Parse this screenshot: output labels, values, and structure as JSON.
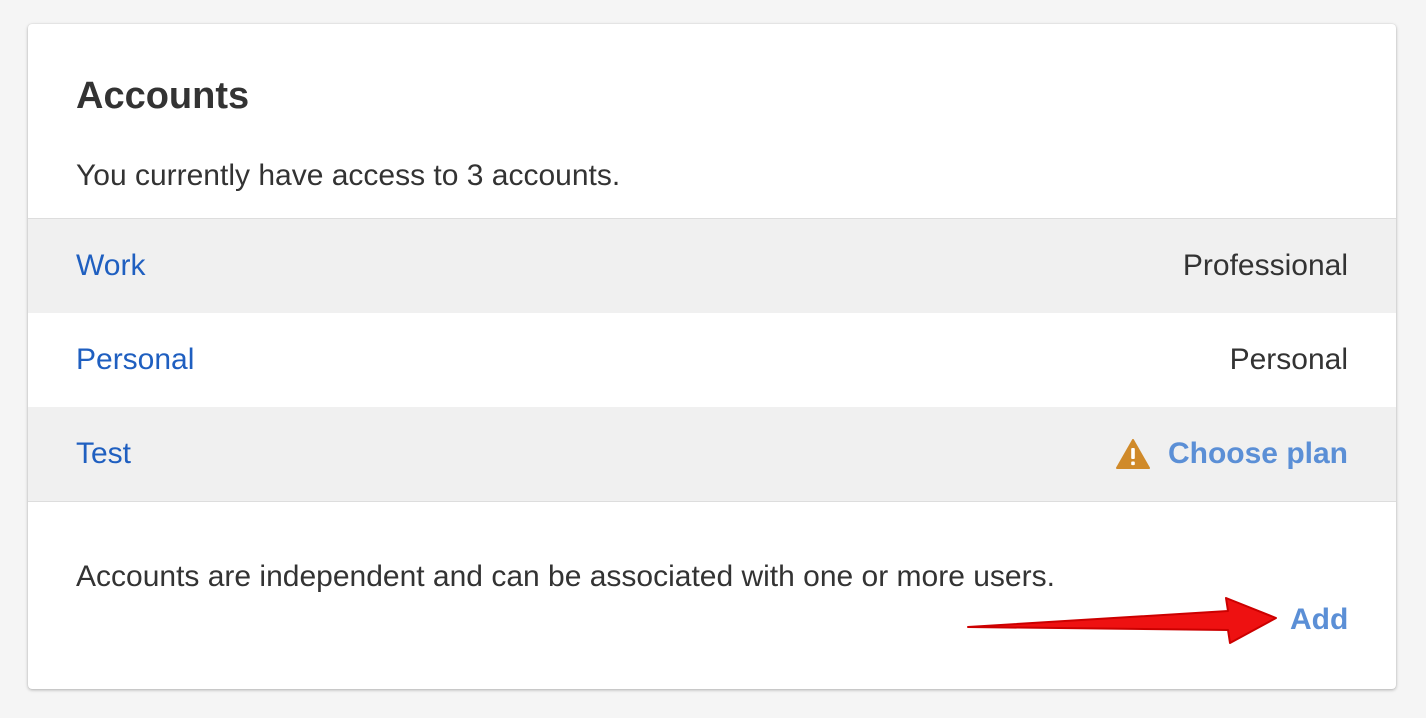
{
  "card": {
    "title": "Accounts",
    "subtitle": "You currently have access to 3 accounts."
  },
  "accounts": [
    {
      "name": "Work",
      "plan": "Professional"
    },
    {
      "name": "Personal",
      "plan": "Personal"
    },
    {
      "name": "Test",
      "action": "Choose plan",
      "icon": "warning-icon"
    }
  ],
  "footer": {
    "description": "Accounts are independent and can be associated with one or more users.",
    "add_label": "Add"
  },
  "colors": {
    "link": "#1f5fc0",
    "action_link": "#5b8fd6",
    "warning": "#d08a2a",
    "arrow": "#ee1111",
    "row_shade": "#f0f0f0"
  }
}
